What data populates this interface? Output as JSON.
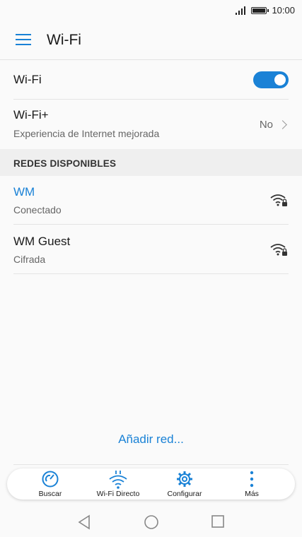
{
  "status_bar": {
    "time": "10:00",
    "signal_icon": "signal-icon",
    "battery_icon": "battery-icon"
  },
  "header": {
    "title": "Wi-Fi",
    "menu_icon": "menu-icon"
  },
  "wifi_toggle": {
    "label": "Wi-Fi",
    "state": "on",
    "accent_color": "#1a82d6"
  },
  "wifi_plus": {
    "label": "Wi-Fi+",
    "subtitle": "Experiencia de Internet mejorada",
    "value": "No"
  },
  "section": {
    "title": "REDES DISPONIBLES"
  },
  "networks": [
    {
      "name": "WM",
      "status": "Conectado",
      "connected": true,
      "icon": "wifi-locked-icon"
    },
    {
      "name": "WM Guest",
      "status": "Cifrada",
      "connected": false,
      "icon": "wifi-locked-icon"
    }
  ],
  "add_network": {
    "label": "Añadir red..."
  },
  "toolbar": {
    "items": [
      {
        "label": "Buscar",
        "icon": "scan-icon"
      },
      {
        "label": "Wi-Fi Directo",
        "icon": "wifi-direct-icon"
      },
      {
        "label": "Configurar",
        "icon": "gear-icon"
      },
      {
        "label": "Más",
        "icon": "more-vertical-icon"
      }
    ]
  },
  "nav_bar": {
    "back_icon": "back-triangle-icon",
    "home_icon": "home-circle-icon",
    "recents_icon": "recents-square-icon"
  }
}
